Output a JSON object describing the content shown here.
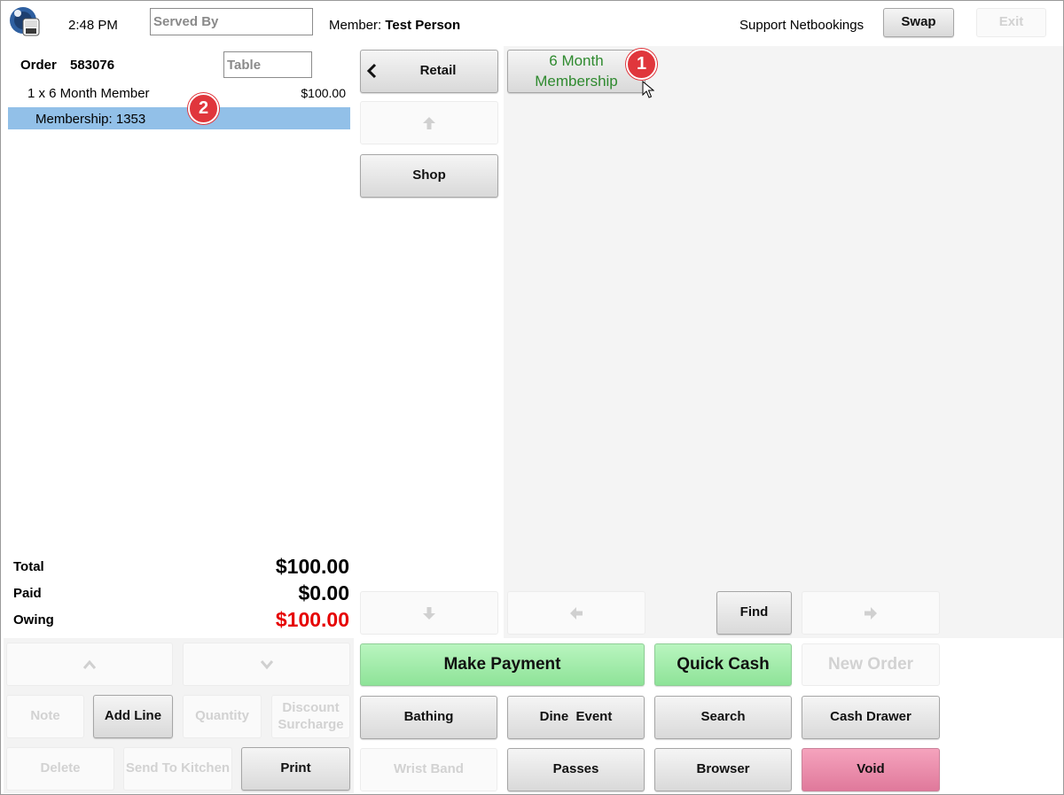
{
  "header": {
    "time": "2:48 PM",
    "served_by_placeholder": "Served By",
    "member_label": "Member:",
    "member_name": "Test Person",
    "support_user": "Support Netbookings",
    "swap_label": "Swap",
    "exit_label": "Exit"
  },
  "order": {
    "label": "Order",
    "number": "583076",
    "table_placeholder": "Table",
    "items": [
      {
        "text": "1 x 6 Month Member",
        "price": "$100.00"
      }
    ],
    "selected_sub": "Membership: 1353",
    "totals": {
      "total_label": "Total",
      "total_value": "$100.00",
      "paid_label": "Paid",
      "paid_value": "$0.00",
      "owing_label": "Owing",
      "owing_value": "$100.00"
    }
  },
  "categories": {
    "retail": "Retail",
    "shop": "Shop"
  },
  "products": [
    {
      "line1": "6 Month",
      "line2": "Membership"
    }
  ],
  "find_label": "Find",
  "badges": {
    "one": "1",
    "two": "2"
  },
  "actions": {
    "note": "Note",
    "add_line": "Add Line",
    "quantity": "Quantity",
    "discount": "Discount",
    "surcharge": "Surcharge",
    "delete": "Delete",
    "send_to_kitchen": "Send To Kitchen",
    "print": "Print",
    "make_payment": "Make Payment",
    "quick_cash": "Quick Cash",
    "new_order": "New Order",
    "bathing": "Bathing",
    "dine_event": "Dine  Event",
    "search": "Search",
    "cash_drawer": "Cash Drawer",
    "wrist_band": "Wrist Band",
    "passes": "Passes",
    "browser": "Browser",
    "void": "Void"
  },
  "colors": {
    "selected_row": "#92c0e8",
    "owing": "#e60000",
    "product_text": "#2f8a2f",
    "payment_green": "#a3eeab",
    "void_pink": "#e88aa9",
    "badge": "#e0363c"
  }
}
